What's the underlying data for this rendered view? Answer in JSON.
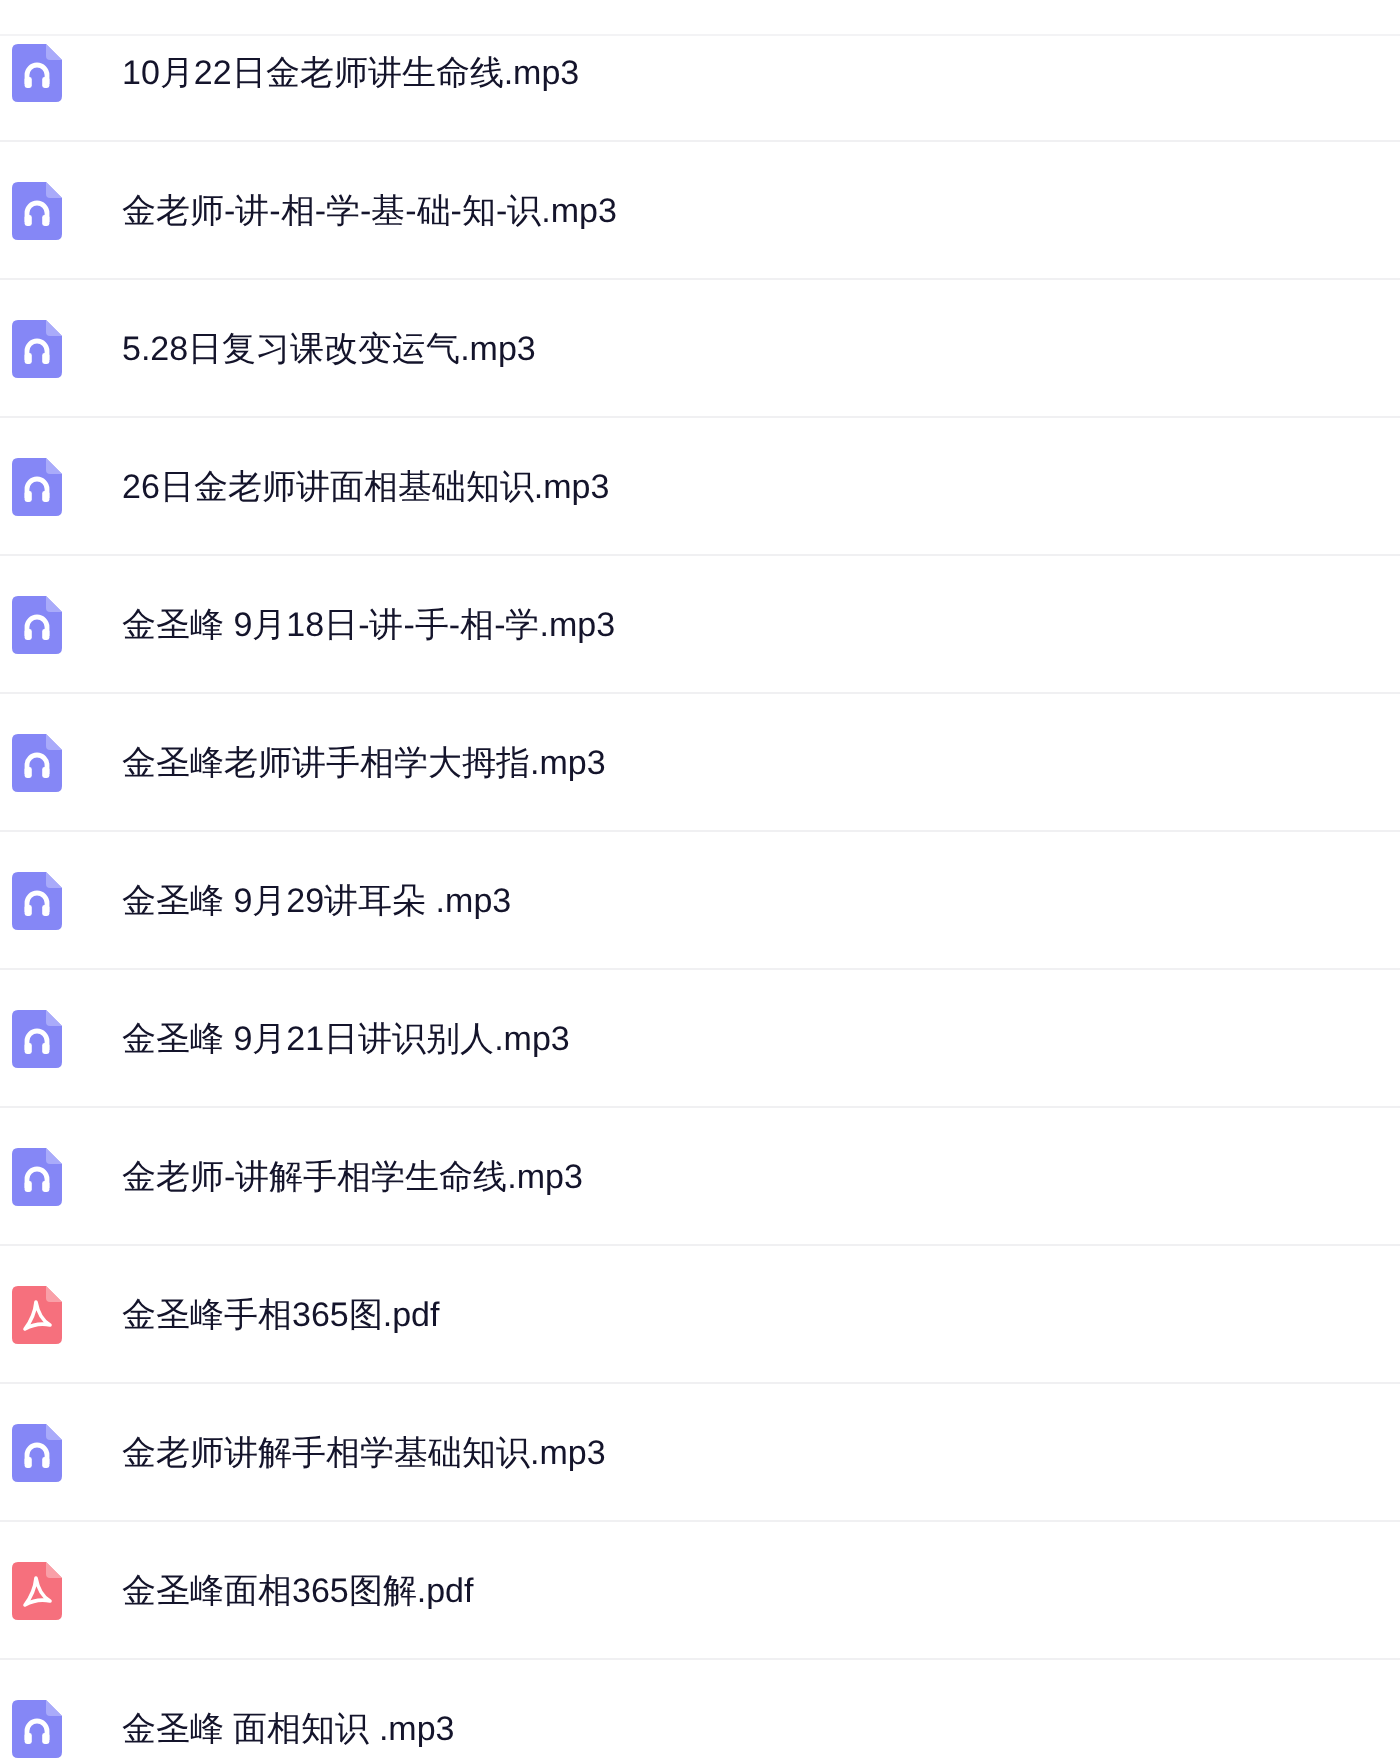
{
  "files": [
    {
      "name": "10月22日金老师讲生命线.mp3",
      "kind": "audio"
    },
    {
      "name": "金老师-讲-相-学-基-础-知-识.mp3",
      "kind": "audio"
    },
    {
      "name": "5.28日复习课改变运气.mp3",
      "kind": "audio"
    },
    {
      "name": "26日金老师讲面相基础知识.mp3",
      "kind": "audio"
    },
    {
      "name": "金圣峰 9月18日-讲-手-相-学.mp3",
      "kind": "audio"
    },
    {
      "name": "金圣峰老师讲手相学大拇指.mp3",
      "kind": "audio"
    },
    {
      "name": "金圣峰 9月29讲耳朵 .mp3",
      "kind": "audio"
    },
    {
      "name": "金圣峰 9月21日讲识别人.mp3",
      "kind": "audio"
    },
    {
      "name": "金老师-讲解手相学生命线.mp3",
      "kind": "audio"
    },
    {
      "name": "金圣峰手相365图.pdf",
      "kind": "pdf"
    },
    {
      "name": "金老师讲解手相学基础知识.mp3",
      "kind": "audio"
    },
    {
      "name": "金圣峰面相365图解.pdf",
      "kind": "pdf"
    },
    {
      "name": "金圣峰 面相知识 .mp3",
      "kind": "audio"
    }
  ]
}
